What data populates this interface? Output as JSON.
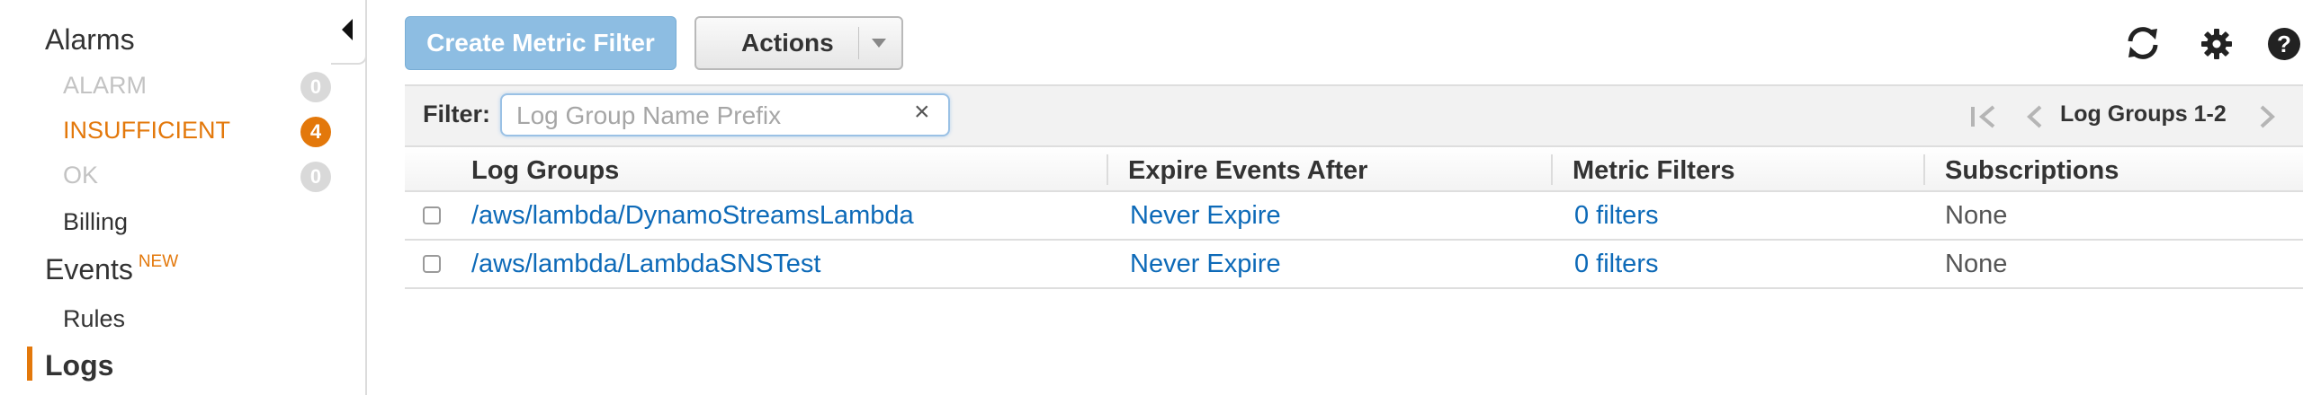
{
  "sidebar": {
    "alarms_heading": "Alarms",
    "alarm_states": [
      {
        "label": "ALARM",
        "count": "0",
        "style": "disabled"
      },
      {
        "label": "INSUFFICIENT",
        "count": "4",
        "style": "warning"
      },
      {
        "label": "OK",
        "count": "0",
        "style": "disabled"
      }
    ],
    "billing": "Billing",
    "events_heading": "Events",
    "events_badge": "NEW",
    "rules": "Rules",
    "logs": "Logs",
    "active_item": "Logs",
    "collapse_icon": "triangle-left-icon"
  },
  "toolbar": {
    "create_label": "Create Metric Filter",
    "actions_label": "Actions",
    "icons": [
      "refresh-icon",
      "gear-icon",
      "help-icon"
    ]
  },
  "filter": {
    "label": "Filter:",
    "placeholder": "Log Group Name Prefix",
    "value": "",
    "clear": "×"
  },
  "pagination": {
    "text": "Log Groups 1-2"
  },
  "table": {
    "columns": [
      "Log Groups",
      "Expire Events After",
      "Metric Filters",
      "Subscriptions"
    ],
    "rows": [
      {
        "log_group": "/aws/lambda/DynamoStreamsLambda",
        "expire": "Never Expire",
        "metric_filters": "0 filters",
        "subscriptions": "None"
      },
      {
        "log_group": "/aws/lambda/LambdaSNSTest",
        "expire": "Never Expire",
        "metric_filters": "0 filters",
        "subscriptions": "None"
      }
    ]
  },
  "colors": {
    "accent_orange": "#e3780b",
    "link_blue": "#0d6ab8",
    "primary_button": "#8dbde2"
  }
}
